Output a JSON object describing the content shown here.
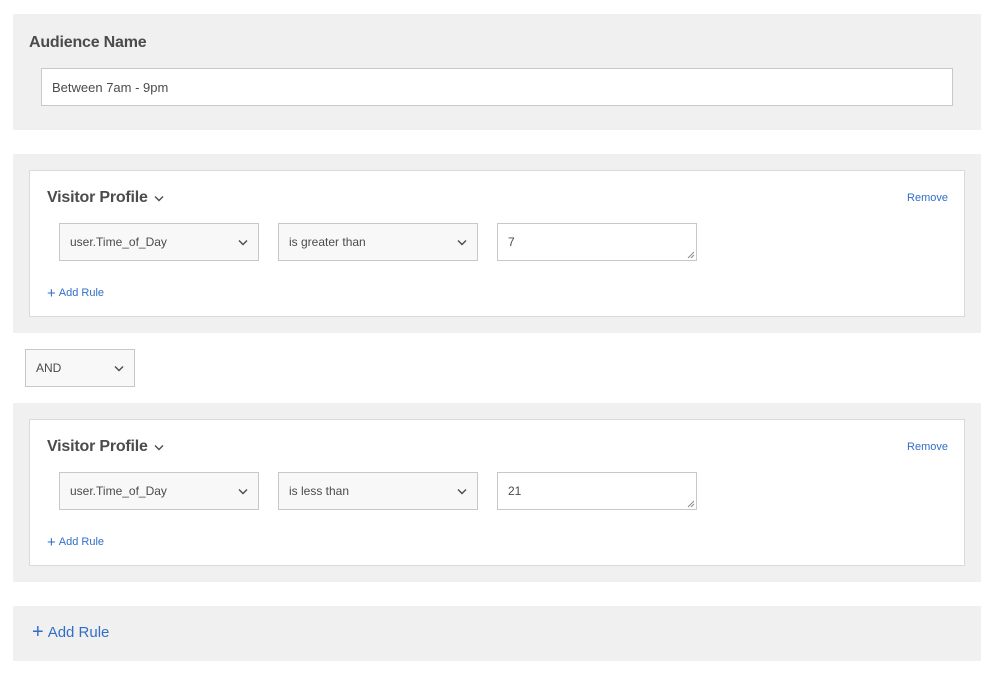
{
  "audience": {
    "title": "Audience Name",
    "value": "Between 7am - 9pm"
  },
  "groups": [
    {
      "title": "Visitor Profile",
      "remove_label": "Remove",
      "attribute": "user.Time_of_Day",
      "operator": "is greater than",
      "value": "7",
      "add_rule_label": "Add Rule"
    },
    {
      "title": "Visitor Profile",
      "remove_label": "Remove",
      "attribute": "user.Time_of_Day",
      "operator": "is less than",
      "value": "21",
      "add_rule_label": "Add Rule"
    }
  ],
  "combinator": {
    "value": "AND"
  },
  "footer": {
    "add_rule_label": "Add Rule"
  },
  "icons": {
    "chevron": "chevron-down-icon",
    "plus": "plus-icon",
    "resize": "resize-grip-icon"
  },
  "colors": {
    "link": "#326ec8",
    "panel": "#f0f0f0",
    "border": "#c8c8c8",
    "text": "#4b4b4b"
  }
}
